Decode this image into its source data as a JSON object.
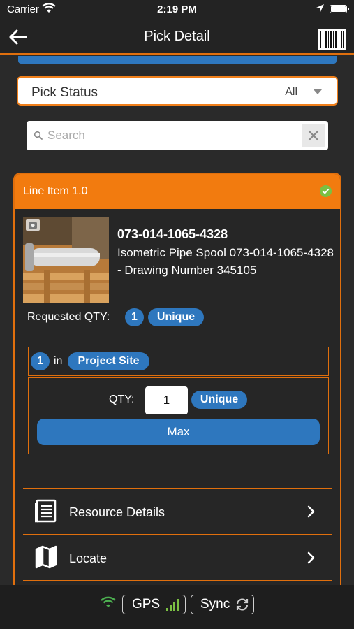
{
  "status_bar": {
    "carrier": "Carrier",
    "time": "2:19 PM"
  },
  "nav": {
    "title": "Pick Detail",
    "back_icon": "back-arrow-icon",
    "barcode_icon": "barcode-icon"
  },
  "filter": {
    "label": "Pick Status",
    "value": "All"
  },
  "search": {
    "placeholder": "Search",
    "value": ""
  },
  "line_item": {
    "title": "Line Item 1.0",
    "status_icon": "check-circle-icon",
    "status_color": "#7bc043",
    "item_number": "073-014-1065-4328",
    "description": "Isometric Pipe Spool 073-014-1065-4328 - Drawing Number 345105",
    "requested_label": "Requested QTY:",
    "requested_qty": "1",
    "requested_unit": "Unique",
    "location_qty": "1",
    "location_in": "in",
    "location_name": "Project Site",
    "qty_label": "QTY:",
    "qty_value": "1",
    "qty_unit": "Unique",
    "max_label": "Max"
  },
  "menu": [
    {
      "label": "Resource Details",
      "icon": "document-list-icon"
    },
    {
      "label": "Locate",
      "icon": "map-icon"
    }
  ],
  "bottom_bar": {
    "gps_label": "GPS",
    "sync_label": "Sync",
    "wifi_color": "#4caf50",
    "signal_color": "#7bc043"
  },
  "colors": {
    "accent": "#f27b0f",
    "primary_blue": "#2e77be",
    "background": "#2a2a2a"
  }
}
